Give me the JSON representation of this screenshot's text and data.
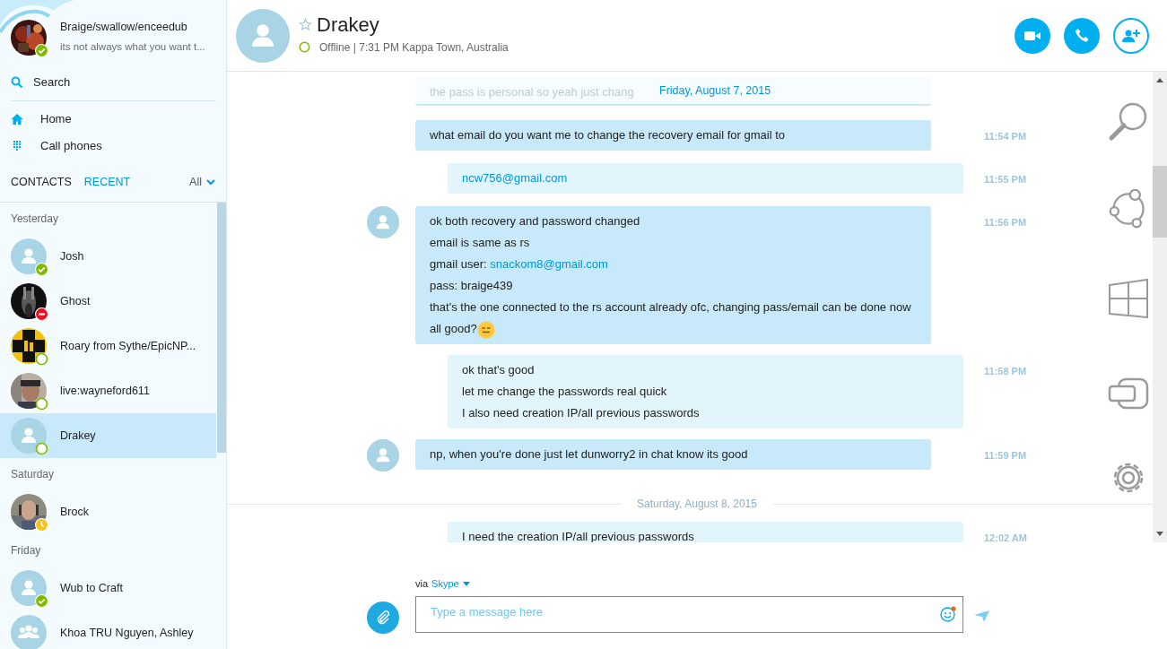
{
  "profile": {
    "name": "Braige/swallow/enceedub",
    "mood": "its not always what you want t...",
    "status": {
      "kind": "online"
    }
  },
  "nav": [
    {
      "label": "Search",
      "kind": "search"
    },
    {
      "label": "Home",
      "kind": "home"
    },
    {
      "label": "Call phones",
      "kind": "dialpad"
    }
  ],
  "tabs": [
    {
      "label": "CONTACTS",
      "selected": false
    },
    {
      "label": "RECENT",
      "selected": true
    }
  ],
  "filter": {
    "label": "All"
  },
  "contact_groups": [
    {
      "label": "Yesterday",
      "contacts": [
        {
          "name": "Josh",
          "status": {
            "kind": "online"
          },
          "avatar": {
            "kind": "default"
          },
          "selected": false
        },
        {
          "name": "Ghost",
          "status": {
            "kind": "busy"
          },
          "selected": false
        },
        {
          "name": "Roary from Sythe/EpicNP...",
          "status": {
            "kind": "offline"
          },
          "selected": false
        },
        {
          "name": "live:wayneford611",
          "status": {
            "kind": "offline"
          },
          "selected": false
        },
        {
          "name": "Drakey",
          "status": {
            "kind": "offline"
          },
          "avatar": {
            "kind": "default"
          },
          "selected": true
        }
      ]
    },
    {
      "label": "Saturday",
      "contacts": [
        {
          "name": "Brock",
          "status": {
            "kind": "away"
          },
          "selected": false
        }
      ]
    },
    {
      "label": "Friday",
      "contacts": [
        {
          "name": "Wub to Craft",
          "status": {
            "kind": "online"
          },
          "avatar": {
            "kind": "default"
          },
          "selected": false
        },
        {
          "name": "Khoa TRU Nguyen, Ashley",
          "avatar": {
            "kind": "group"
          },
          "selected": false
        }
      ]
    }
  ],
  "conversation": {
    "name": "Drakey",
    "favorite": false,
    "status": {
      "kind": "offline"
    },
    "status_text": "Offline | 7:31 PM Kappa Town, Australia"
  },
  "sticky_date": "Friday, August 7, 2015",
  "messages": [
    {
      "kind": "faded",
      "lines": [
        [
          {
            "kind": "plain",
            "text": "the pass is personal so yeah just chang"
          }
        ]
      ]
    },
    {
      "kind": "incoming",
      "avatar": false,
      "time": "11:54 PM",
      "lines": [
        [
          {
            "kind": "plain",
            "text": "what email do you want me to change the recovery email for gmail to"
          }
        ]
      ]
    },
    {
      "kind": "outgoing",
      "time": "11:55 PM",
      "lines": [
        [
          {
            "kind": "link",
            "text": "ncw756@gmail.com"
          }
        ]
      ]
    },
    {
      "kind": "incoming",
      "avatar": true,
      "time": "11:56 PM",
      "lines": [
        [
          {
            "kind": "plain",
            "text": "ok both recovery and password changed"
          }
        ],
        [
          {
            "kind": "plain",
            "text": "email is same as rs"
          }
        ],
        [
          {
            "kind": "plain",
            "text": "gmail user: "
          },
          {
            "kind": "link",
            "text": "snackom8@gmail.com"
          }
        ],
        [
          {
            "kind": "plain",
            "text": "pass: braige439"
          }
        ],
        [
          {
            "kind": "plain",
            "text": "that's the one connected to the rs account already ofc, changing pass/email can be done now"
          }
        ],
        [
          {
            "kind": "plain",
            "text": "all good?"
          },
          {
            "kind": "emoji"
          }
        ]
      ]
    },
    {
      "kind": "outgoing",
      "time": "11:58 PM",
      "lines": [
        [
          {
            "kind": "plain",
            "text": "ok that's good"
          }
        ],
        [
          {
            "kind": "plain",
            "text": "let me change the passwords real quick"
          }
        ],
        [
          {
            "kind": "plain",
            "text": "I also need creation IP/all previous passwords"
          }
        ]
      ]
    },
    {
      "kind": "incoming",
      "avatar": true,
      "time": "11:59 PM",
      "lines": [
        [
          {
            "kind": "plain",
            "text": "np, when you're done just let dunworry2 in chat know its good"
          }
        ]
      ]
    },
    {
      "kind": "date",
      "label": "Saturday, August 8, 2015"
    },
    {
      "kind": "outgoing",
      "time": "12:02 AM",
      "lines": [
        [
          {
            "kind": "plain",
            "text": "I need the creation IP/all previous passwords"
          }
        ]
      ]
    }
  ],
  "composer": {
    "via": "via",
    "service": "Skype",
    "placeholder": "Type a message here"
  }
}
